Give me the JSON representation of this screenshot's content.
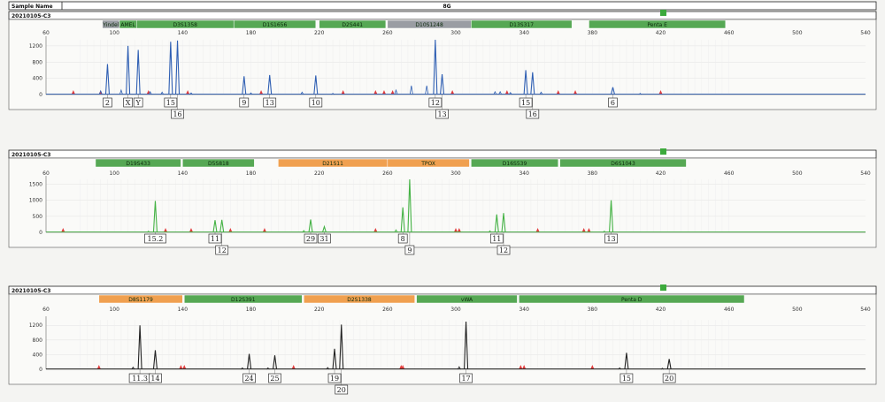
{
  "header": {
    "sample_name_label": "Sample Name",
    "title": "8G"
  },
  "colors": {
    "blue_trace": "#2f5fb3",
    "green_trace": "#44b244",
    "black_trace": "#222222",
    "marker_green": "#56a854",
    "marker_orange": "#f0a050",
    "marker_gray": "#9a9da3",
    "red_peak": "#e23c3c",
    "indicator": "#3caa3c"
  },
  "chart_data": [
    {
      "type": "line",
      "sample": "20210105-C3",
      "trace_color": "#2f5fb3",
      "x_ticks": [
        "60",
        "100",
        "140",
        "180",
        "220",
        "260",
        "300",
        "340",
        "380",
        "420",
        "460",
        "500",
        "540"
      ],
      "xlim": [
        60,
        540
      ],
      "y_ticks": [
        "1200",
        "800",
        "400",
        "0"
      ],
      "ylim": [
        0,
        1350
      ],
      "markers": [
        {
          "name": "Yindel",
          "start": 93,
          "end": 103,
          "color": "#9a9da3"
        },
        {
          "name": "AMEL",
          "start": 103,
          "end": 113,
          "color": "#56a854"
        },
        {
          "name": "D3S1358",
          "start": 113,
          "end": 170,
          "color": "#56a854"
        },
        {
          "name": "D1S1656",
          "start": 170,
          "end": 218,
          "color": "#56a854"
        },
        {
          "name": "D2S441",
          "start": 220,
          "end": 259,
          "color": "#56a854"
        },
        {
          "name": "D10S1248",
          "start": 260,
          "end": 309,
          "color": "#9a9da3"
        },
        {
          "name": "D13S317",
          "start": 309,
          "end": 368,
          "color": "#56a854"
        },
        {
          "name": "Penta E",
          "start": 378,
          "end": 458,
          "color": "#56a854"
        }
      ],
      "peaks": [
        {
          "x": 96,
          "y": 750,
          "alleles": [
            "2"
          ],
          "row": 0
        },
        {
          "x": 108,
          "y": 1200,
          "alleles": [
            "X"
          ],
          "row": 0
        },
        {
          "x": 114,
          "y": 1100,
          "alleles": [
            "Y"
          ],
          "row": 0
        },
        {
          "x": 133,
          "y": 1300,
          "alleles": [
            "15"
          ],
          "row": 0
        },
        {
          "x": 137,
          "y": 1330,
          "alleles": [
            "16"
          ],
          "row": 1
        },
        {
          "x": 176,
          "y": 450,
          "alleles": [
            "9"
          ],
          "row": 0
        },
        {
          "x": 191,
          "y": 480,
          "alleles": [
            "13"
          ],
          "row": 0
        },
        {
          "x": 218,
          "y": 470,
          "alleles": [
            "10"
          ],
          "row": 0
        },
        {
          "x": 288,
          "y": 1350,
          "alleles": [
            "12"
          ],
          "row": 0
        },
        {
          "x": 292,
          "y": 500,
          "alleles": [
            "13"
          ],
          "row": 1
        },
        {
          "x": 341,
          "y": 600,
          "alleles": [
            "15"
          ],
          "row": 0
        },
        {
          "x": 345,
          "y": 550,
          "alleles": [
            "16"
          ],
          "row": 1
        },
        {
          "x": 392,
          "y": 180,
          "alleles": [
            "6"
          ],
          "row": 0
        }
      ],
      "minor_peaks": [
        {
          "x": 92,
          "y": 90
        },
        {
          "x": 104,
          "y": 110
        },
        {
          "x": 121,
          "y": 70
        },
        {
          "x": 128,
          "y": 60
        },
        {
          "x": 145,
          "y": 40
        },
        {
          "x": 180,
          "y": 40
        },
        {
          "x": 210,
          "y": 60
        },
        {
          "x": 228,
          "y": 30
        },
        {
          "x": 265,
          "y": 110
        },
        {
          "x": 274,
          "y": 220
        },
        {
          "x": 283,
          "y": 220
        },
        {
          "x": 323,
          "y": 70
        },
        {
          "x": 326,
          "y": 70
        },
        {
          "x": 332,
          "y": 50
        },
        {
          "x": 350,
          "y": 60
        },
        {
          "x": 408,
          "y": 30
        }
      ],
      "red_peaks": [
        76,
        92,
        120,
        143,
        186,
        234,
        253,
        258,
        263,
        298,
        330,
        360,
        370,
        420
      ]
    },
    {
      "type": "line",
      "sample": "20210105-C3",
      "trace_color": "#44b244",
      "x_ticks": [
        "60",
        "100",
        "140",
        "180",
        "220",
        "260",
        "300",
        "340",
        "380",
        "420",
        "460",
        "500",
        "540"
      ],
      "xlim": [
        60,
        540
      ],
      "y_ticks": [
        "1500",
        "1000",
        "500",
        "0"
      ],
      "ylim": [
        0,
        1650
      ],
      "markers": [
        {
          "name": "D19S433",
          "start": 89,
          "end": 139,
          "color": "#56a854"
        },
        {
          "name": "D5S818",
          "start": 140,
          "end": 182,
          "color": "#56a854"
        },
        {
          "name": "D21S11",
          "start": 196,
          "end": 260,
          "color": "#f0a050"
        },
        {
          "name": "TPOX",
          "start": 260,
          "end": 308,
          "color": "#f0a050"
        },
        {
          "name": "D16S539",
          "start": 309,
          "end": 360,
          "color": "#56a854"
        },
        {
          "name": "D6S1043",
          "start": 361,
          "end": 435,
          "color": "#56a854"
        }
      ],
      "peaks": [
        {
          "x": 124,
          "y": 980,
          "alleles": [
            "15.2"
          ],
          "row": 0
        },
        {
          "x": 159,
          "y": 380,
          "alleles": [
            "11"
          ],
          "row": 0
        },
        {
          "x": 163,
          "y": 390,
          "alleles": [
            "12"
          ],
          "row": 1
        },
        {
          "x": 215,
          "y": 400,
          "alleles": [
            "29"
          ],
          "row": 0
        },
        {
          "x": 223,
          "y": 180,
          "alleles": [
            "31"
          ],
          "row": 0
        },
        {
          "x": 269,
          "y": 780,
          "alleles": [
            "8"
          ],
          "row": 0
        },
        {
          "x": 273,
          "y": 1650,
          "alleles": [
            "9"
          ],
          "row": 1
        },
        {
          "x": 324,
          "y": 560,
          "alleles": [
            "11"
          ],
          "row": 0
        },
        {
          "x": 328,
          "y": 600,
          "alleles": [
            "12"
          ],
          "row": 1
        },
        {
          "x": 391,
          "y": 1000,
          "alleles": [
            "13"
          ],
          "row": 0
        }
      ],
      "minor_peaks": [
        {
          "x": 120,
          "y": 40
        },
        {
          "x": 211,
          "y": 60
        },
        {
          "x": 265,
          "y": 80
        },
        {
          "x": 320,
          "y": 50
        },
        {
          "x": 387,
          "y": 40
        }
      ],
      "red_peaks": [
        70,
        130,
        145,
        168,
        188,
        253,
        300,
        302,
        348,
        375,
        378
      ]
    },
    {
      "type": "line",
      "sample": "20210105-C3",
      "trace_color": "#222222",
      "x_ticks": [
        "60",
        "100",
        "140",
        "180",
        "220",
        "260",
        "300",
        "340",
        "380",
        "420",
        "460",
        "500",
        "540"
      ],
      "xlim": [
        60,
        540
      ],
      "y_ticks": [
        "1200",
        "800",
        "400",
        "0"
      ],
      "ylim": [
        0,
        1350
      ],
      "markers": [
        {
          "name": "D8S1179",
          "start": 91,
          "end": 140,
          "color": "#f0a050"
        },
        {
          "name": "D12S391",
          "start": 141,
          "end": 210,
          "color": "#56a854"
        },
        {
          "name": "D2S1338",
          "start": 211,
          "end": 276,
          "color": "#f0a050"
        },
        {
          "name": "vWA",
          "start": 277,
          "end": 336,
          "color": "#56a854"
        },
        {
          "name": "Penta D",
          "start": 337,
          "end": 469,
          "color": "#56a854"
        }
      ],
      "peaks": [
        {
          "x": 115,
          "y": 1200,
          "alleles": [
            "11.3"
          ],
          "row": 0
        },
        {
          "x": 124,
          "y": 520,
          "alleles": [
            "14"
          ],
          "row": 0
        },
        {
          "x": 179,
          "y": 420,
          "alleles": [
            "24"
          ],
          "row": 0
        },
        {
          "x": 194,
          "y": 380,
          "alleles": [
            "25"
          ],
          "row": 0
        },
        {
          "x": 229,
          "y": 560,
          "alleles": [
            "19"
          ],
          "row": 0
        },
        {
          "x": 233,
          "y": 1220,
          "alleles": [
            "20"
          ],
          "row": 1
        },
        {
          "x": 306,
          "y": 1300,
          "alleles": [
            "17"
          ],
          "row": 0
        },
        {
          "x": 400,
          "y": 450,
          "alleles": [
            "15"
          ],
          "row": 0
        },
        {
          "x": 425,
          "y": 280,
          "alleles": [
            "20"
          ],
          "row": 0
        }
      ],
      "minor_peaks": [
        {
          "x": 111,
          "y": 60
        },
        {
          "x": 175,
          "y": 40
        },
        {
          "x": 190,
          "y": 40
        },
        {
          "x": 225,
          "y": 50
        },
        {
          "x": 302,
          "y": 70
        },
        {
          "x": 396,
          "y": 40
        },
        {
          "x": 421,
          "y": 30
        }
      ],
      "red_peaks": [
        91,
        139,
        141,
        205,
        268,
        269,
        338,
        340,
        380
      ]
    }
  ]
}
